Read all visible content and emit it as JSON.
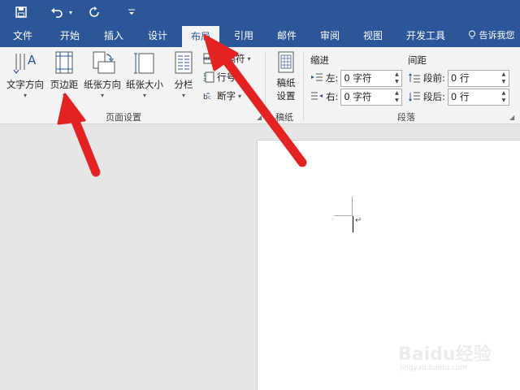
{
  "quick_access": {
    "icons": [
      "save-icon",
      "undo-icon",
      "redo-icon",
      "customize-qat-icon"
    ]
  },
  "tabs": [
    {
      "label": "文件"
    },
    {
      "label": "开始"
    },
    {
      "label": "插入"
    },
    {
      "label": "设计"
    },
    {
      "label": "布局",
      "active": true
    },
    {
      "label": "引用"
    },
    {
      "label": "邮件"
    },
    {
      "label": "审阅"
    },
    {
      "label": "视图"
    },
    {
      "label": "开发工具"
    }
  ],
  "tell_me": "告诉我您",
  "page_setup": {
    "text_direction": "文字方向",
    "margins": "页边距",
    "orientation": "纸张方向",
    "size": "纸张大小",
    "columns": "分栏",
    "breaks": "分隔符",
    "line_numbers": "行号",
    "hyphenation": "断字",
    "group_label": "页面设置"
  },
  "manuscript": {
    "button_line1": "稿纸",
    "button_line2": "设置",
    "group_label": "稿纸"
  },
  "paragraph": {
    "indent_head": "缩进",
    "spacing_head": "间距",
    "left_label": "左:",
    "left_value": "0 字符",
    "right_label": "右:",
    "right_value": "0 字符",
    "before_label": "段前:",
    "before_value": "0 行",
    "after_label": "段后:",
    "after_value": "0 行",
    "group_label": "段落"
  },
  "document": {
    "paragraph_mark": "↵"
  },
  "watermark": {
    "logo": "Baidu经验",
    "url": "jingyan.baidu.com"
  },
  "colors": {
    "title_bar": "#2b579a",
    "ribbon": "#f3f3f3",
    "canvas": "#e6e6e6",
    "annotation_arrow": "#e52222"
  }
}
